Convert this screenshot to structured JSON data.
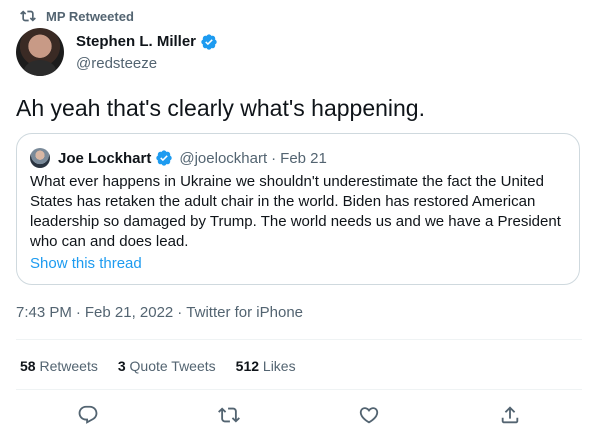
{
  "retweet": {
    "label": "MP Retweeted",
    "icon": "retweet-icon"
  },
  "author": {
    "name": "Stephen L. Miller",
    "handle": "@redsteeze",
    "verified_icon": "verified-badge-icon"
  },
  "tweet": {
    "text": "Ah yeah that's clearly what's happening."
  },
  "quote": {
    "name": "Joe Lockhart",
    "handle": "@joelockhart",
    "separator": "·",
    "date": "Feb 21",
    "body": "What ever happens in Ukraine we shouldn't underestimate the fact the United States has retaken the adult chair in the world. Biden has restored American leadership so damaged by Trump. The world needs us and we have a President who can and does lead.",
    "show_thread": "Show this thread"
  },
  "meta": {
    "time": "7:43 PM",
    "sep1": "·",
    "date": "Feb 21, 2022",
    "sep2": "·",
    "source": "Twitter for iPhone"
  },
  "stats": {
    "retweets_count": "58",
    "retweets_label": "Retweets",
    "quotes_count": "3",
    "quotes_label": "Quote Tweets",
    "likes_count": "512",
    "likes_label": "Likes"
  },
  "actions": {
    "reply": "reply-icon",
    "retweet": "retweet-icon",
    "like": "like-icon",
    "share": "share-icon"
  },
  "colors": {
    "accent": "#1d9bf0",
    "secondary_text": "#536471",
    "primary_text": "#0f1419",
    "border": "#cfd9de"
  }
}
